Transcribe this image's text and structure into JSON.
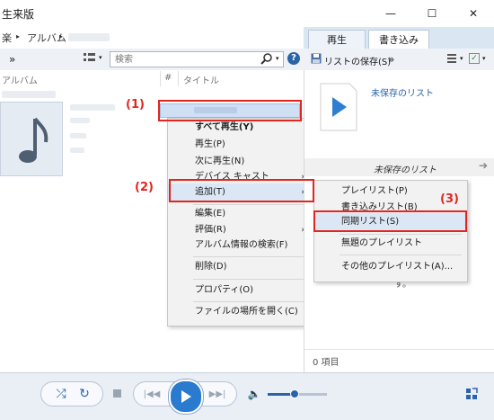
{
  "window": {
    "title": "生来版",
    "minimize": "—",
    "maximize": "☐",
    "close": "✕"
  },
  "breadcrumb": {
    "items": [
      "楽",
      "アルバム"
    ],
    "sep": "▸"
  },
  "tabs": {
    "play": "再生",
    "burn": "書き込み"
  },
  "toolbar": {
    "more": "»",
    "search_placeholder": "検索",
    "help": "?"
  },
  "right_toolbar": {
    "save_list": "リストの保存(S)",
    "more": "»"
  },
  "columns": {
    "album": "アルバム",
    "num": "#",
    "title": "タイトル"
  },
  "right_pane": {
    "unsaved_list": "未保存のリスト",
    "unsaved_list_header": "未保存のリスト",
    "empty_hint": "す。",
    "status": "0 項目"
  },
  "context_menu": {
    "items": [
      {
        "label": "すべて再生(Y)",
        "bold": true
      },
      {
        "label": "再生(P)"
      },
      {
        "label": "次に再生(N)"
      },
      {
        "label": "デバイス キャスト",
        "submenu": true
      },
      {
        "label": "追加(T)",
        "submenu": true
      },
      {
        "label": "編集(E)"
      },
      {
        "label": "評価(R)",
        "submenu": true
      },
      {
        "label": "アルバム情報の検索(F)"
      },
      {
        "label": "削除(D)"
      },
      {
        "label": "プロパティ(O)"
      },
      {
        "label": "ファイルの場所を開く(C)"
      }
    ]
  },
  "submenu": {
    "items": [
      {
        "label": "プレイリスト(P)"
      },
      {
        "label": "書き込みリスト(B)"
      },
      {
        "label": "同期リスト(S)"
      },
      {
        "label": "無題のプレイリスト"
      },
      {
        "label": "その他のプレイリスト(A)..."
      }
    ]
  },
  "annotations": {
    "one": "(1)",
    "two": "(2)",
    "three": "(3)"
  },
  "player": {
    "volume": 0.45
  },
  "colors": {
    "accent": "#2a63a8",
    "annotation": "#e0261f",
    "highlight": "#cfe0f5"
  }
}
